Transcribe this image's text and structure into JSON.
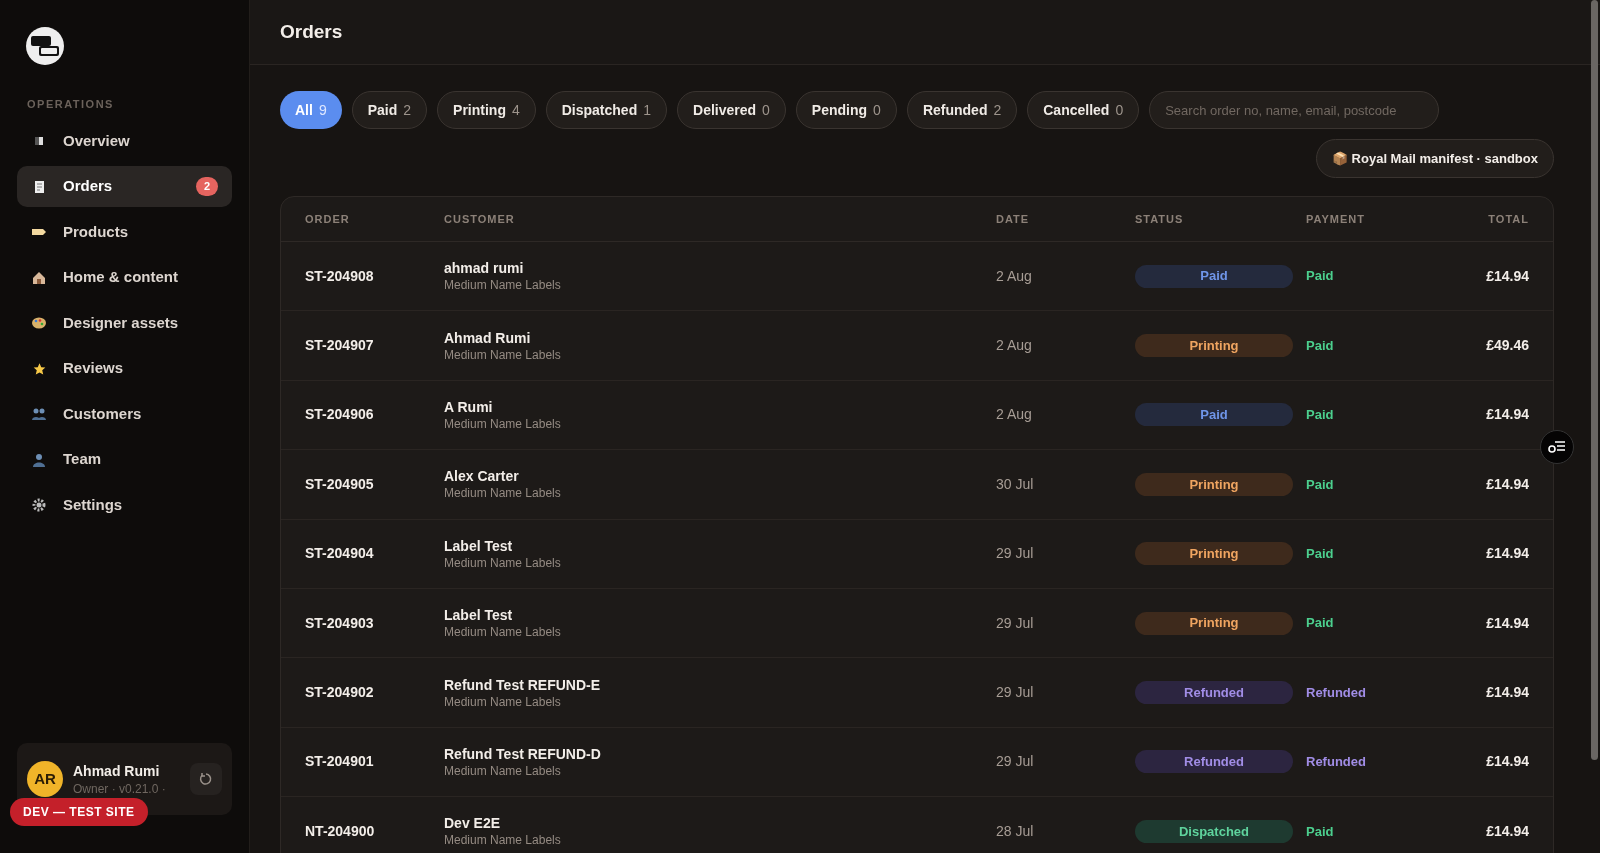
{
  "sidebar": {
    "section_label": "OPERATIONS",
    "items": [
      {
        "label": "Overview",
        "selected": false
      },
      {
        "label": "Orders",
        "selected": true,
        "badge": "2"
      },
      {
        "label": "Products",
        "selected": false
      },
      {
        "label": "Home & content",
        "selected": false
      },
      {
        "label": "Designer assets",
        "selected": false
      },
      {
        "label": "Reviews",
        "selected": false
      },
      {
        "label": "Customers",
        "selected": false
      },
      {
        "label": "Team",
        "selected": false
      },
      {
        "label": "Settings",
        "selected": false
      }
    ],
    "user": {
      "initials": "AR",
      "name": "Ahmad Rumi",
      "role": "Owner · v0.21.0 ·"
    },
    "env_badge": "DEV — TEST SITE"
  },
  "header": {
    "title": "Orders"
  },
  "filters": [
    {
      "label": "All",
      "count": "9",
      "selected": true
    },
    {
      "label": "Paid",
      "count": "2",
      "selected": false
    },
    {
      "label": "Printing",
      "count": "4",
      "selected": false
    },
    {
      "label": "Dispatched",
      "count": "1",
      "selected": false
    },
    {
      "label": "Delivered",
      "count": "0",
      "selected": false
    },
    {
      "label": "Pending",
      "count": "0",
      "selected": false
    },
    {
      "label": "Refunded",
      "count": "2",
      "selected": false
    },
    {
      "label": "Cancelled",
      "count": "0",
      "selected": false
    }
  ],
  "search": {
    "placeholder": "Search order no, name, email, postcode"
  },
  "manifest_button": "📦 Royal Mail manifest · sandbox",
  "table": {
    "columns": [
      "ORDER",
      "CUSTOMER",
      "DATE",
      "STATUS",
      "PAYMENT",
      "TOTAL"
    ],
    "rows": [
      {
        "order": "ST-204908",
        "customer": "ahmad rumi",
        "product": "Medium Name Labels",
        "date": "2 Aug",
        "status": {
          "text": "Paid",
          "kind": "paid"
        },
        "payment": {
          "text": "Paid",
          "kind": "paid"
        },
        "total": "£14.94"
      },
      {
        "order": "ST-204907",
        "customer": "Ahmad Rumi",
        "product": "Medium Name Labels",
        "date": "2 Aug",
        "status": {
          "text": "Printing",
          "kind": "printing"
        },
        "payment": {
          "text": "Paid",
          "kind": "paid"
        },
        "total": "£49.46"
      },
      {
        "order": "ST-204906",
        "customer": "A Rumi",
        "product": "Medium Name Labels",
        "date": "2 Aug",
        "status": {
          "text": "Paid",
          "kind": "paid"
        },
        "payment": {
          "text": "Paid",
          "kind": "paid"
        },
        "total": "£14.94"
      },
      {
        "order": "ST-204905",
        "customer": "Alex Carter",
        "product": "Medium Name Labels",
        "date": "30 Jul",
        "status": {
          "text": "Printing",
          "kind": "printing"
        },
        "payment": {
          "text": "Paid",
          "kind": "paid"
        },
        "total": "£14.94"
      },
      {
        "order": "ST-204904",
        "customer": "Label Test",
        "product": "Medium Name Labels",
        "date": "29 Jul",
        "status": {
          "text": "Printing",
          "kind": "printing"
        },
        "payment": {
          "text": "Paid",
          "kind": "paid"
        },
        "total": "£14.94"
      },
      {
        "order": "ST-204903",
        "customer": "Label Test",
        "product": "Medium Name Labels",
        "date": "29 Jul",
        "status": {
          "text": "Printing",
          "kind": "printing"
        },
        "payment": {
          "text": "Paid",
          "kind": "paid"
        },
        "total": "£14.94"
      },
      {
        "order": "ST-204902",
        "customer": "Refund Test REFUND-E",
        "product": "Medium Name Labels",
        "date": "29 Jul",
        "status": {
          "text": "Refunded",
          "kind": "refunded"
        },
        "payment": {
          "text": "Refunded",
          "kind": "refunded"
        },
        "total": "£14.94"
      },
      {
        "order": "ST-204901",
        "customer": "Refund Test REFUND-D",
        "product": "Medium Name Labels",
        "date": "29 Jul",
        "status": {
          "text": "Refunded",
          "kind": "refunded"
        },
        "payment": {
          "text": "Refunded",
          "kind": "refunded"
        },
        "total": "£14.94"
      },
      {
        "order": "NT-204900",
        "customer": "Dev E2E",
        "product": "Medium Name Labels",
        "date": "28 Jul",
        "status": {
          "text": "Dispatched",
          "kind": "dispatched"
        },
        "payment": {
          "text": "Paid",
          "kind": "paid"
        },
        "total": "£14.94"
      }
    ]
  }
}
